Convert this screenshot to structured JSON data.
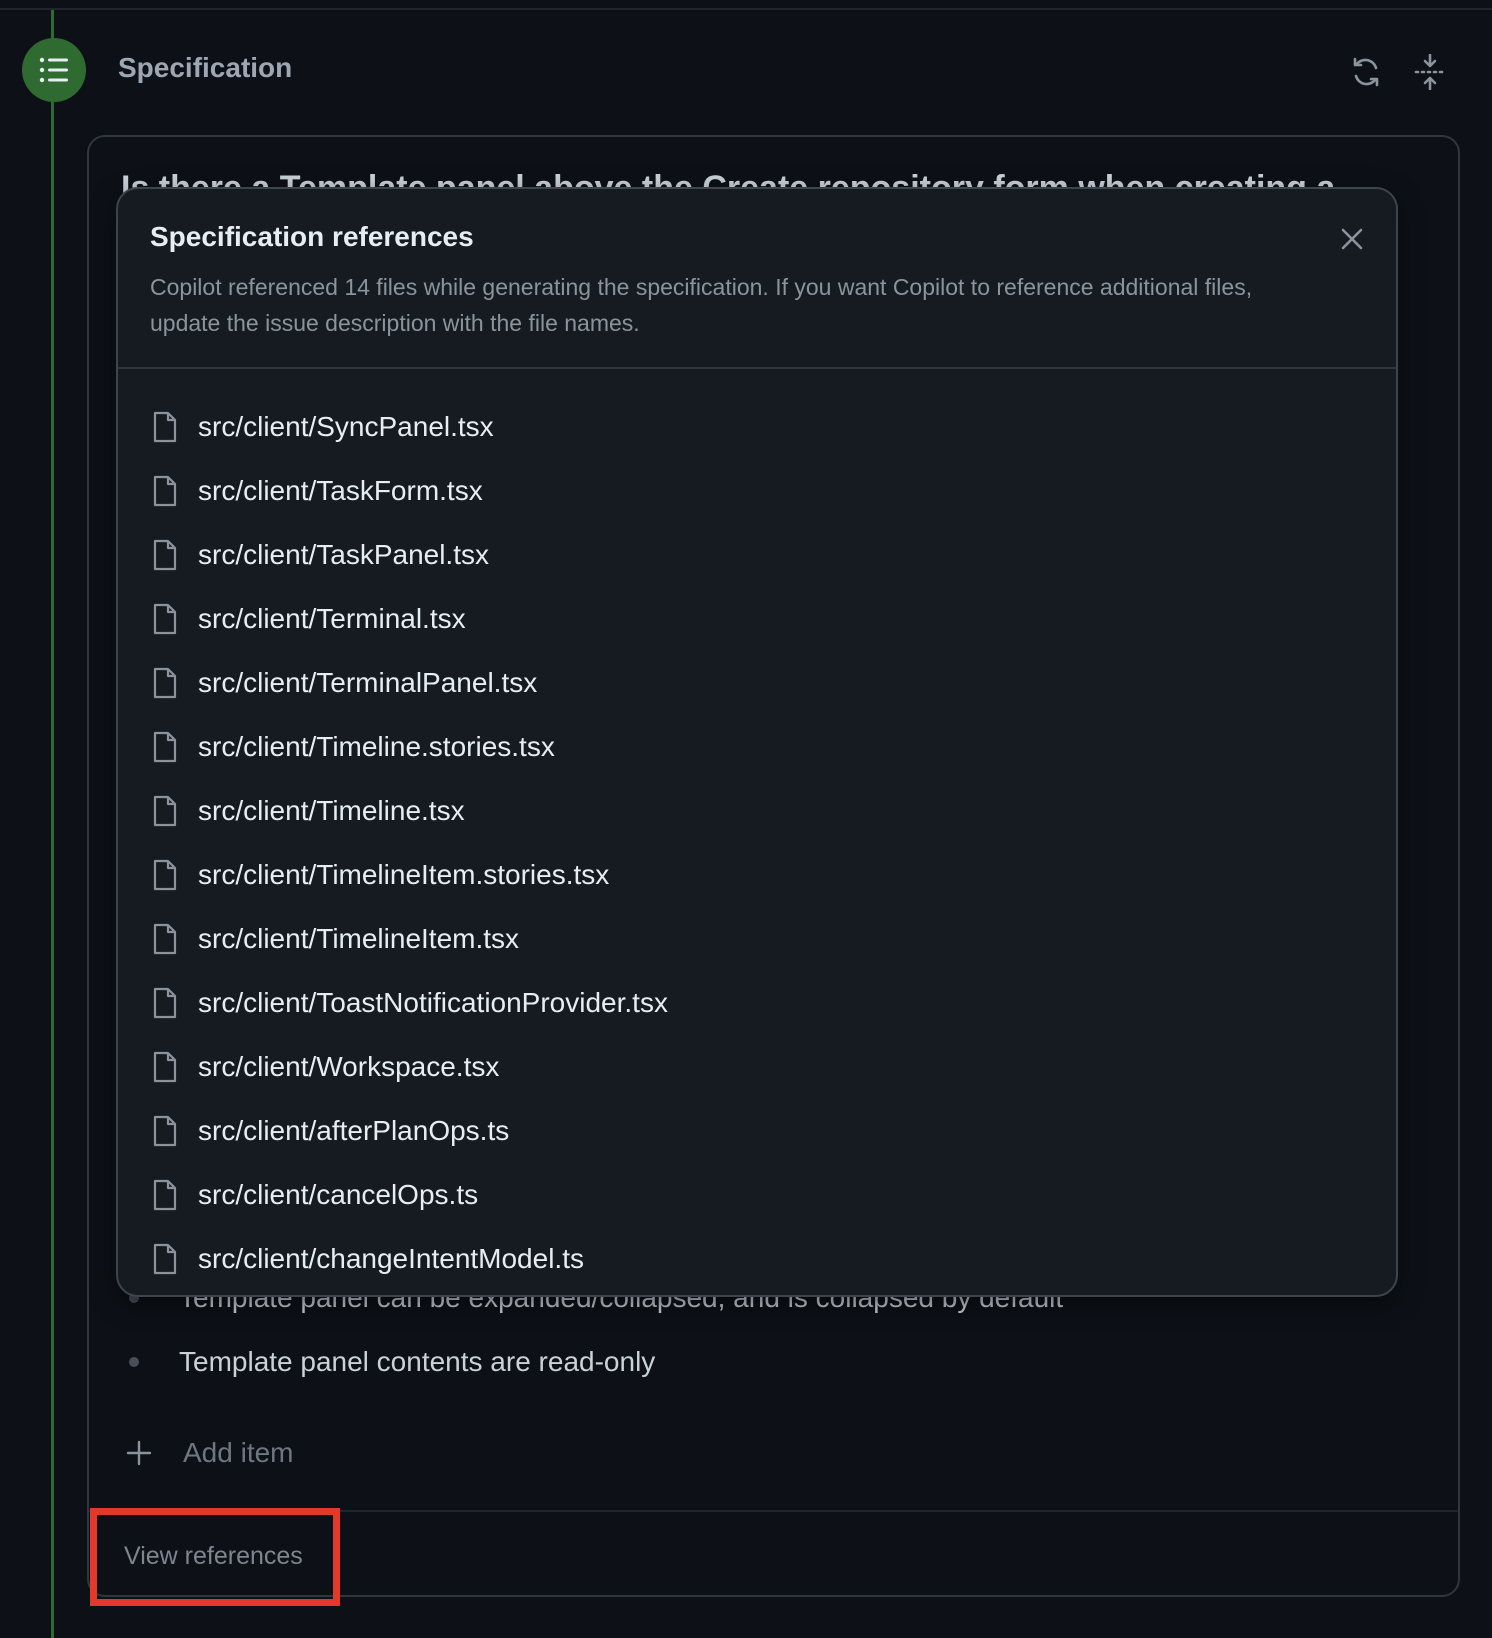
{
  "step": {
    "title": "Specification",
    "refresh_icon": "refresh-icon",
    "collapse_icon": "collapse-vertical-icon"
  },
  "card": {
    "question_partial": "Is there a Template panel above the Create repository form when creating a",
    "bullets": [
      "Template panel can be expanded/collapsed, and is collapsed by default",
      "Template panel contents are read-only"
    ],
    "add_item_label": "Add item",
    "view_references_label": "View references"
  },
  "popover": {
    "title": "Specification references",
    "description": "Copilot referenced 14 files while generating the specification. If you want Copilot to reference additional files, update the issue description with the file names.",
    "close_icon": "close-icon",
    "files": [
      "src/client/SyncPanel.tsx",
      "src/client/TaskForm.tsx",
      "src/client/TaskPanel.tsx",
      "src/client/Terminal.tsx",
      "src/client/TerminalPanel.tsx",
      "src/client/Timeline.stories.tsx",
      "src/client/Timeline.tsx",
      "src/client/TimelineItem.stories.tsx",
      "src/client/TimelineItem.tsx",
      "src/client/ToastNotificationProvider.tsx",
      "src/client/Workspace.tsx",
      "src/client/afterPlanOps.ts",
      "src/client/cancelOps.ts",
      "src/client/changeIntentModel.ts"
    ]
  },
  "colors": {
    "background": "#0d1117",
    "popover_bg": "#161b22",
    "accent_green": "#2f6a31",
    "highlight_red": "#e3392c"
  }
}
